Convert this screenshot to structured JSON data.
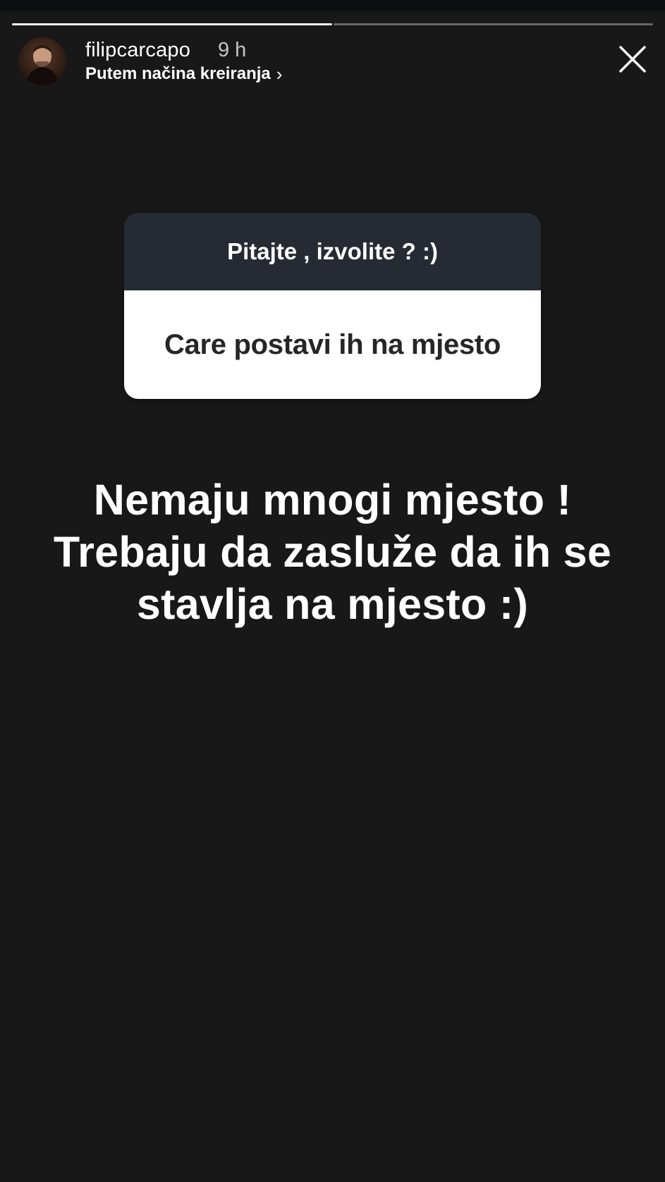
{
  "story": {
    "progress": {
      "segments_total": 2,
      "segments_completed": 1
    },
    "header": {
      "username": "filipcarcapo",
      "time_ago": "9 h",
      "subline": "Putem načina kreiranja",
      "subline_icon": "chevron-right-icon",
      "close_icon": "close-icon"
    },
    "question_sticker": {
      "question": "Pitajte , izvolite ? :)",
      "answer": "Care postavi ih na mjesto",
      "header_color": "#262a32",
      "body_color": "#ffffff"
    },
    "reply_text": {
      "lines": [
        "Nemaju mnogi mjesto !",
        "Trebaju da zasluže da ih se",
        "stavlja na mjesto :)"
      ]
    },
    "background_color": "#181818"
  }
}
